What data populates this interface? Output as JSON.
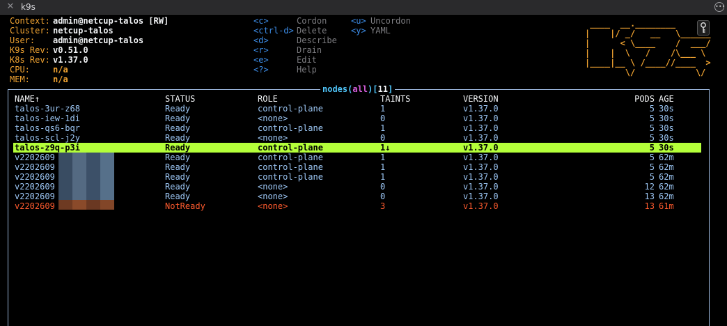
{
  "window": {
    "title": "k9s"
  },
  "info": [
    {
      "key": "Context:",
      "value": "admin@netcup-talos [RW]"
    },
    {
      "key": "Cluster:",
      "value": "netcup-talos"
    },
    {
      "key": "User:",
      "value": "admin@netcup-talos"
    },
    {
      "key": "K9s Rev:",
      "value": "v0.51.0"
    },
    {
      "key": "K8s Rev:",
      "value": "v1.37.0"
    },
    {
      "key": "CPU:",
      "value": "n/a"
    },
    {
      "key": "MEM:",
      "value": "n/a"
    }
  ],
  "shortcuts_col1": [
    {
      "key": "<c>",
      "action": "Cordon"
    },
    {
      "key": "<ctrl-d>",
      "action": "Delete"
    },
    {
      "key": "<d>",
      "action": "Describe"
    },
    {
      "key": "<r>",
      "action": "Drain"
    },
    {
      "key": "<e>",
      "action": "Edit"
    },
    {
      "key": "<?>",
      "action": "Help"
    }
  ],
  "shortcuts_col2": [
    {
      "key": "<u>",
      "action": "Uncordon"
    },
    {
      "key": "<y>",
      "action": "YAML"
    }
  ],
  "view": {
    "resource": "nodes",
    "namespace": "all",
    "count": "11"
  },
  "table": {
    "columns": [
      "NAME↑",
      "STATUS",
      "ROLE",
      "TAINTS",
      "VERSION",
      "PODS",
      "AGE"
    ],
    "rows": [
      {
        "name": "talos-3ur-z68",
        "status": "Ready",
        "role": "control-plane",
        "taints": "1",
        "version": "v1.37.0",
        "pods": "5",
        "age": "30s",
        "state": "normal"
      },
      {
        "name": "talos-iew-1di",
        "status": "Ready",
        "role": "<none>",
        "taints": "0",
        "version": "v1.37.0",
        "pods": "5",
        "age": "30s",
        "state": "normal"
      },
      {
        "name": "talos-qs6-bqr",
        "status": "Ready",
        "role": "control-plane",
        "taints": "1",
        "version": "v1.37.0",
        "pods": "5",
        "age": "30s",
        "state": "normal"
      },
      {
        "name": "talos-scl-j2y",
        "status": "Ready",
        "role": "<none>",
        "taints": "0",
        "version": "v1.37.0",
        "pods": "5",
        "age": "30s",
        "state": "normal"
      },
      {
        "name": "talos-z9q-p3i",
        "status": "Ready",
        "role": "control-plane",
        "taints": "1↓",
        "version": "v1.37.0",
        "pods": "5",
        "age": "30s",
        "state": "selected"
      },
      {
        "name": "v2202609",
        "status": "Ready",
        "role": "control-plane",
        "taints": "1",
        "version": "v1.37.0",
        "pods": "5",
        "age": "62m",
        "state": "normal"
      },
      {
        "name": "v2202609",
        "status": "Ready",
        "role": "control-plane",
        "taints": "1",
        "version": "v1.37.0",
        "pods": "5",
        "age": "62m",
        "state": "normal"
      },
      {
        "name": "v2202609",
        "status": "Ready",
        "role": "control-plane",
        "taints": "1",
        "version": "v1.37.0",
        "pods": "5",
        "age": "62m",
        "state": "normal"
      },
      {
        "name": "v2202609",
        "status": "Ready",
        "role": "<none>",
        "taints": "0",
        "version": "v1.37.0",
        "pods": "12",
        "age": "62m",
        "state": "normal"
      },
      {
        "name": "v2202609",
        "status": "Ready",
        "role": "<none>",
        "taints": "0",
        "version": "v1.37.0",
        "pods": "13",
        "age": "62m",
        "state": "normal"
      },
      {
        "name": "v2202609",
        "status": "NotReady",
        "role": "<none>",
        "taints": "3",
        "version": "v1.37.0",
        "pods": "13",
        "age": "61m",
        "state": "bad"
      }
    ]
  },
  "icons": {
    "close": "close-icon",
    "more": "more-icon",
    "lock": "key-icon"
  }
}
